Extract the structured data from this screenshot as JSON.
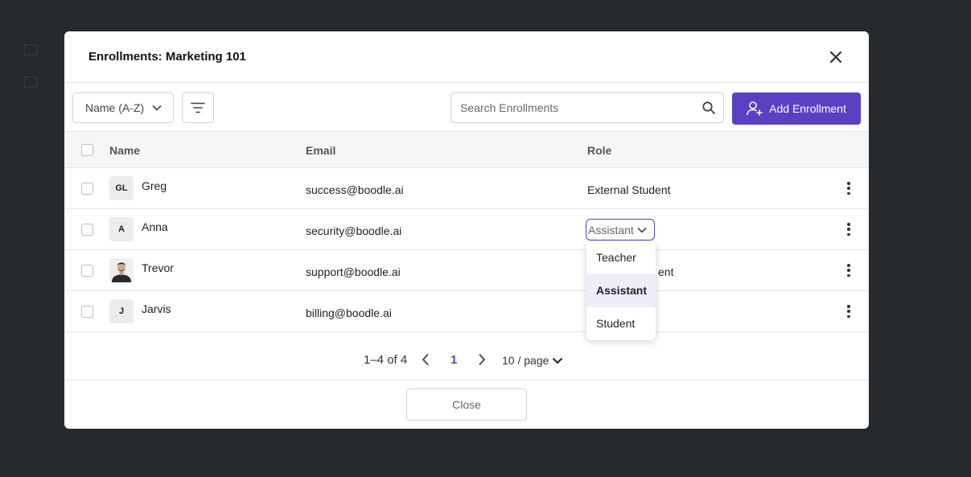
{
  "modal": {
    "title": "Enrollments: Marketing 101"
  },
  "toolbar": {
    "sort_value": "Name (A-Z)",
    "search_placeholder": "Search Enrollments",
    "add_label": "Add Enrollment"
  },
  "table": {
    "headers": {
      "name": "Name",
      "email": "Email",
      "role": "Role"
    },
    "rows": [
      {
        "initials": "GL",
        "name": "Greg",
        "email": "success@boodle.ai",
        "role": "External Student"
      },
      {
        "initials": "A",
        "name": "Anna",
        "email": "security@boodle.ai",
        "role": "Assistant"
      },
      {
        "initials": "",
        "name": "Trevor",
        "email": "support@boodle.ai",
        "role": "ent"
      },
      {
        "initials": "J",
        "name": "Jarvis",
        "email": "billing@boodle.ai",
        "role": ""
      }
    ]
  },
  "role_dropdown": {
    "options": [
      "Teacher",
      "Assistant",
      "Student"
    ],
    "selected": "Assistant"
  },
  "pagination": {
    "range": "1–4 of 4",
    "current_page": "1",
    "page_size": "10 / page"
  },
  "footer": {
    "close_label": "Close"
  },
  "colors": {
    "accent": "#5a40c2",
    "backdrop": "#26292d"
  }
}
